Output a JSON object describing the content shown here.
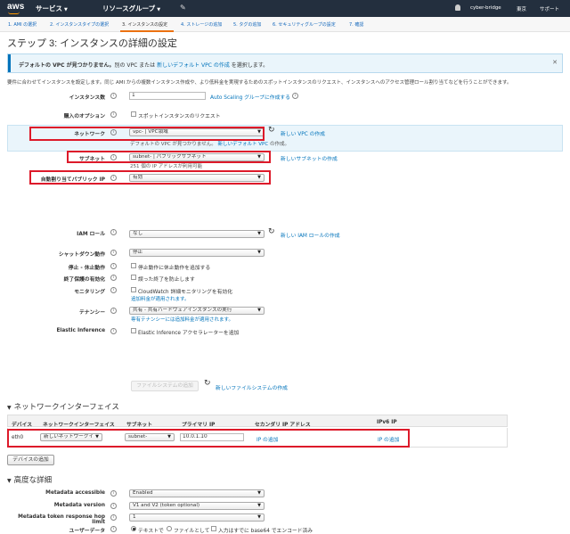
{
  "topnav": {
    "logo": "aws",
    "services": "サービス",
    "resource_groups": "リソースグループ",
    "account": "cyber-bridge",
    "region": "東京",
    "support": "サポート"
  },
  "steps": [
    "1. AMI の選択",
    "2. インスタンスタイプの選択",
    "3. インスタンスの設定",
    "4. ストレージの追加",
    "5. タグの追加",
    "6. セキュリティグループの設定",
    "7. 確認"
  ],
  "page_title": "ステップ 3: インスタンスの詳細の設定",
  "info": {
    "bold": "デフォルトの VPC が見つかりません。",
    "text": "別の VPC または",
    "link": "新しいデフォルト VPC の作成",
    "suffix": "を選択します。"
  },
  "description": "要件に合わせてインスタンスを設定します。同じ AMI からの複数インスタンス作成や、より低料金を実現するためのスポットインスタンスのリクエスト、インスタンスへのアクセス管理ロール割り当てなどを行うことができます。",
  "form": {
    "instance_count": {
      "label": "インスタンス数",
      "value": "1",
      "link": "Auto Scaling グループに作成する"
    },
    "purchase": {
      "label": "購入のオプション",
      "checkbox": "スポットインスタンスのリクエスト"
    },
    "network": {
      "label": "ネットワーク",
      "select_value": "vpc-                    | VPC領域",
      "link": "新しい VPC の作成",
      "note_prefix": "デフォルトの VPC が見つかりません。",
      "note_link": "新しいデフォルト VPC",
      "note_suffix": "の作成。"
    },
    "subnet": {
      "label": "サブネット",
      "select_value": "subnet-                       | パブリックサブネット",
      "link": "新しいサブネットの作成",
      "note": "251 個の IP アドレスが利用可能"
    },
    "auto_ip": {
      "label": "自動割り当てパブリック IP",
      "select_value": "有効"
    },
    "iam_role": {
      "label": "IAM ロール",
      "select_value": "なし",
      "link": "新しい IAM ロールの作成"
    },
    "shutdown": {
      "label": "シャットダウン動作",
      "select_value": "停止"
    },
    "stop_hibernate": {
      "label": "停止 - 休止動作",
      "checkbox": "停止動作に休止動作を追加する"
    },
    "termination": {
      "label": "終了保護の有効化",
      "checkbox": "誤った終了を防止します"
    },
    "monitoring": {
      "label": "モニタリング",
      "checkbox": "CloudWatch 詳細モニタリングを有効化",
      "note": "追加料金が適用されます。"
    },
    "tenancy": {
      "label": "テナンシー",
      "select_value": "共有 - 共有ハードウェアインスタンスの実行",
      "note": "専有テナンシーには追加料金が適用されます。"
    },
    "elastic_inference": {
      "label": "Elastic Inference",
      "checkbox": "Elastic Inference アクセラレーターを追加"
    },
    "file_system": {
      "button": "ファイルシステムの追加",
      "link": "新しいファイルシステムの作成"
    }
  },
  "network_interfaces": {
    "title": "ネットワークインターフェイス",
    "headers": [
      "デバイス",
      "ネットワークインターフェイス",
      "サブネット",
      "プライマリ IP",
      "セカンダリ IP アドレス",
      "IPv6 IP"
    ],
    "row": {
      "device": "eth0",
      "interface": "新しいネットワークイ",
      "subnet": "subnet-",
      "primary_ip": "10.0.1.10",
      "secondary_link": "IP の追加",
      "ipv6_link": "IP の追加"
    },
    "add_button": "デバイスの追加"
  },
  "advanced": {
    "title": "高度な詳細",
    "metadata_accessible": {
      "label": "Metadata accessible",
      "value": "Enabled"
    },
    "metadata_version": {
      "label": "Metadata version",
      "value": "V1 and V2 (token optional)"
    },
    "hop_limit": {
      "label": "Metadata token response hop limit",
      "value": "1"
    },
    "user_data": {
      "label": "ユーザーデータ",
      "opt1": "テキストで",
      "opt2": "ファイルとして",
      "opt3": "入力はすでに base64 でエンコード済み"
    }
  },
  "colors": {
    "accent": "#ec7211",
    "link": "#0073bb",
    "highlight": "#dd1a2a",
    "nav": "#232f3e"
  },
  "icons": [
    "help-icon",
    "refresh-icon",
    "close-icon",
    "pin-icon",
    "bell-icon",
    "triangle-down-icon"
  ]
}
